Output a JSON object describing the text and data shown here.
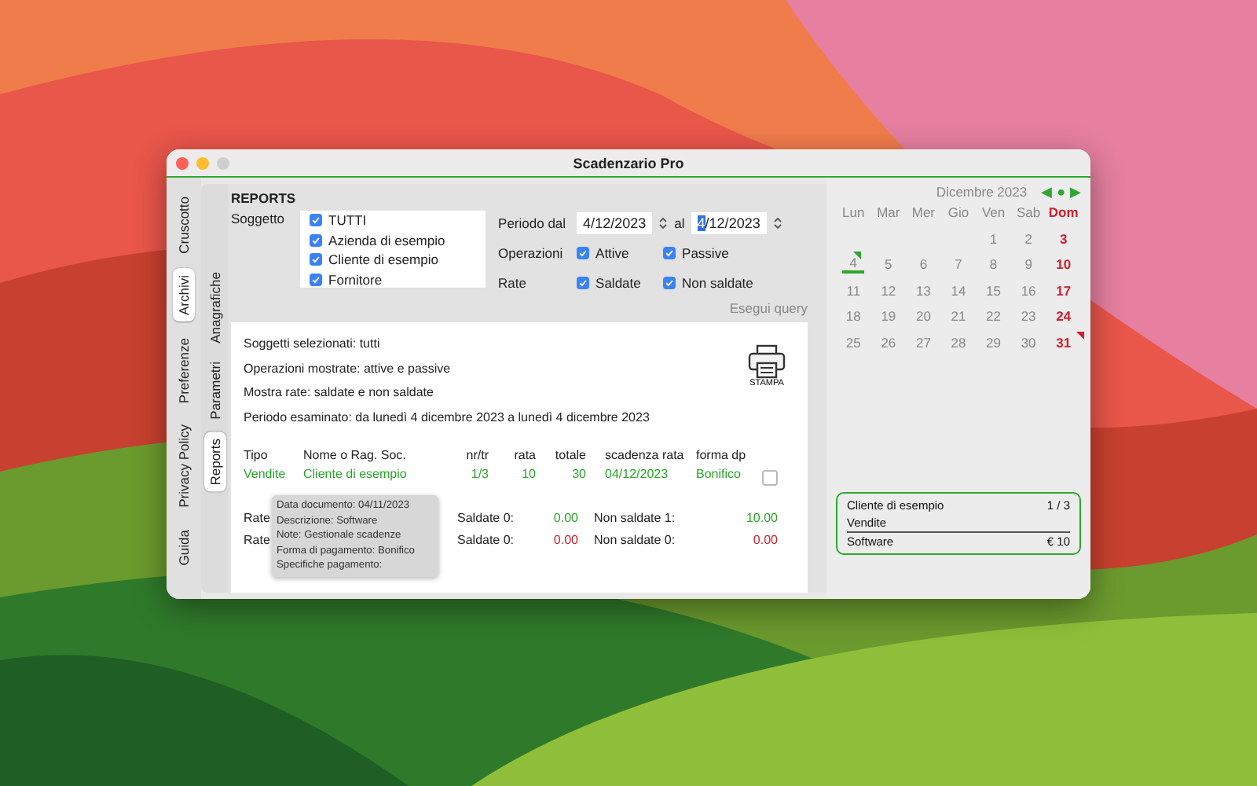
{
  "window": {
    "title": "Scadenzario Pro"
  },
  "main_tabs": [
    {
      "label": "Cruscotto",
      "selected": false
    },
    {
      "label": "Archivi",
      "selected": true
    },
    {
      "label": "Preferenze",
      "selected": false
    },
    {
      "label": "Privacy Policy",
      "selected": false
    },
    {
      "label": "Guida",
      "selected": false
    }
  ],
  "sub_tabs": [
    {
      "label": "Anagrafiche",
      "selected": false
    },
    {
      "label": "Parametri",
      "selected": false
    },
    {
      "label": "Reports",
      "selected": true
    }
  ],
  "reports": {
    "heading": "REPORTS",
    "subject_label": "Soggetto",
    "subjects": [
      {
        "label": "TUTTI",
        "checked": true
      },
      {
        "label": "Azienda di esempio",
        "checked": true
      },
      {
        "label": "Cliente di esempio",
        "checked": true
      },
      {
        "label": "Fornitore",
        "checked": true
      }
    ],
    "period_label": "Periodo dal",
    "from": {
      "value": "4/12/2023",
      "focused": false
    },
    "to_label": "al",
    "to": {
      "value": "4/12/2023",
      "focused": true
    },
    "option_rows": [
      {
        "label": "Operazioni",
        "options": [
          {
            "label": "Attive",
            "checked": true
          },
          {
            "label": "Passive",
            "checked": true
          }
        ]
      },
      {
        "label": "Rate",
        "options": [
          {
            "label": "Saldate",
            "checked": true
          },
          {
            "label": "Non saldate",
            "checked": true
          }
        ]
      }
    ],
    "query_button": "Esegui query"
  },
  "result": {
    "summary": [
      "Soggetti selezionati: tutti",
      "Operazioni mostrate: attive e passive",
      "Mostra rate: saldate e non saldate",
      "Periodo esaminato: da lunedì 4 dicembre 2023 a lunedì 4 dicembre 2023"
    ],
    "print_button": "STAMPA",
    "columns": [
      "Tipo",
      "Nome o Rag. Soc.",
      "nr/tr",
      "rata",
      "totale",
      "scadenza rata",
      "forma dp"
    ],
    "rows": [
      {
        "color": "#2aa52a",
        "checked": false,
        "cells": [
          "Vendite",
          "Cliente di esempio",
          "1/3",
          "10",
          "30",
          "04/12/2023",
          "Bonifico"
        ]
      }
    ],
    "totals": [
      {
        "color": "#2aa52a",
        "label": "Rate",
        "paid_label": "Saldate 0:",
        "paid": "0.00",
        "unpaid_label": "Non saldate 1:",
        "unpaid": "10.00"
      },
      {
        "color": "#d0202e",
        "label": "Rate",
        "paid_label": "Saldate 0:",
        "paid": "0.00",
        "unpaid_label": "Non saldate 0:",
        "unpaid": "0.00"
      }
    ],
    "tooltip": [
      "Data documento: 04/11/2023",
      "Descrizione: Software",
      "Note: Gestionale scadenze",
      "Forma di pagamento: Bonifico",
      "Specifiche pagamento:"
    ]
  },
  "calendar": {
    "title": "Dicembre 2023",
    "prev": "◀",
    "today_button": "●",
    "next": "▶",
    "weekdays": [
      {
        "label": "Lun",
        "holiday": false
      },
      {
        "label": "Mar",
        "holiday": false
      },
      {
        "label": "Mer",
        "holiday": false
      },
      {
        "label": "Gio",
        "holiday": false
      },
      {
        "label": "Ven",
        "holiday": false
      },
      {
        "label": "Sab",
        "holiday": false
      },
      {
        "label": "Dom",
        "holiday": true
      }
    ],
    "weeks": [
      {
        "days": [
          {
            "kind": "blank"
          },
          {
            "kind": "blank"
          },
          {
            "kind": "blank"
          },
          {
            "kind": "blank"
          },
          {
            "kind": "day",
            "label": "1",
            "today": false,
            "event": false
          },
          {
            "label": "2",
            "today": false,
            "event": false
          },
          {
            "label": "3",
            "today": false,
            "event": false
          }
        ]
      },
      {
        "days": [
          {
            "label": "4",
            "today": true,
            "event": true
          },
          {
            "label": "5",
            "today": false,
            "event": false
          },
          {
            "label": "6",
            "today": false,
            "event": false
          },
          {
            "label": "7",
            "today": false,
            "event": false
          },
          {
            "label": "8",
            "today": false,
            "event": false
          },
          {
            "label": "9",
            "today": false,
            "event": false
          },
          {
            "label": "10",
            "today": false,
            "event": false
          }
        ]
      },
      {
        "days": [
          {
            "label": "11",
            "today": false,
            "event": false
          },
          {
            "label": "12",
            "today": false,
            "event": false
          },
          {
            "label": "13",
            "today": false,
            "event": false
          },
          {
            "label": "14",
            "today": false,
            "event": false
          },
          {
            "label": "15",
            "today": false,
            "event": false
          },
          {
            "label": "16",
            "today": false,
            "event": false
          },
          {
            "label": "17",
            "today": false,
            "event": false
          }
        ]
      },
      {
        "days": [
          {
            "label": "18",
            "today": false,
            "event": false
          },
          {
            "label": "19",
            "today": false,
            "event": false
          },
          {
            "label": "20",
            "today": false,
            "event": false
          },
          {
            "label": "21",
            "today": false,
            "event": false
          },
          {
            "label": "22",
            "today": false,
            "event": false
          },
          {
            "label": "23",
            "today": false,
            "event": false
          },
          {
            "label": "24",
            "today": false,
            "event": false
          }
        ]
      },
      {
        "days": [
          {
            "label": "25",
            "today": false,
            "event": false
          },
          {
            "label": "26",
            "today": false,
            "event": false
          },
          {
            "label": "27",
            "today": false,
            "event": false
          },
          {
            "label": "28",
            "today": false,
            "event": false
          },
          {
            "label": "29",
            "today": false,
            "event": false
          },
          {
            "label": "30",
            "today": false,
            "event": false
          },
          {
            "label": "31",
            "today": false,
            "event": true
          }
        ]
      }
    ],
    "event_card": {
      "name": "Cliente di esempio",
      "installment": "1 / 3",
      "type": "Vendite",
      "description": "Software",
      "amount": "€ 10"
    }
  }
}
